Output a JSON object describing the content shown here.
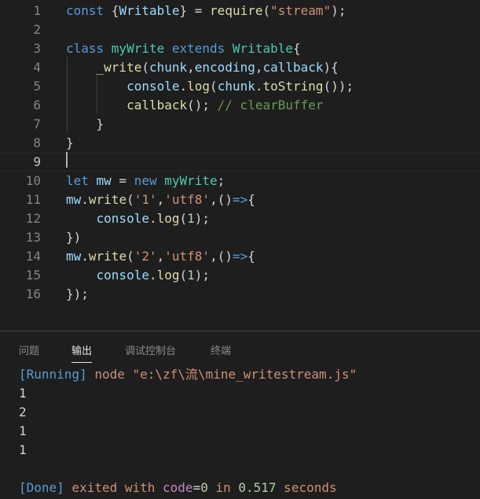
{
  "editor": {
    "line_numbers": [
      "1",
      "2",
      "3",
      "4",
      "5",
      "6",
      "7",
      "8",
      "9",
      "10",
      "11",
      "12",
      "13",
      "14",
      "15",
      "16"
    ],
    "lines": [
      [
        {
          "t": "const ",
          "c": "kw"
        },
        {
          "t": "{",
          "c": "punc"
        },
        {
          "t": "Writable",
          "c": "var"
        },
        {
          "t": "}",
          "c": "punc"
        },
        {
          "t": " = ",
          "c": "punc"
        },
        {
          "t": "require",
          "c": "fn"
        },
        {
          "t": "(",
          "c": "punc"
        },
        {
          "t": "\"stream\"",
          "c": "str"
        },
        {
          "t": ");",
          "c": "punc"
        }
      ],
      [],
      [
        {
          "t": "class ",
          "c": "kw"
        },
        {
          "t": "myWrite ",
          "c": "cls"
        },
        {
          "t": "extends ",
          "c": "kw"
        },
        {
          "t": "Writable",
          "c": "cls"
        },
        {
          "t": "{",
          "c": "punc"
        }
      ],
      [
        {
          "t": "    ",
          "c": "punc"
        },
        {
          "t": "_write",
          "c": "fn"
        },
        {
          "t": "(",
          "c": "punc"
        },
        {
          "t": "chunk",
          "c": "var"
        },
        {
          "t": ",",
          "c": "punc"
        },
        {
          "t": "encoding",
          "c": "var"
        },
        {
          "t": ",",
          "c": "punc"
        },
        {
          "t": "callback",
          "c": "var"
        },
        {
          "t": "){",
          "c": "punc"
        }
      ],
      [
        {
          "t": "        ",
          "c": "punc"
        },
        {
          "t": "console",
          "c": "var"
        },
        {
          "t": ".",
          "c": "punc"
        },
        {
          "t": "log",
          "c": "fn"
        },
        {
          "t": "(",
          "c": "punc"
        },
        {
          "t": "chunk",
          "c": "var"
        },
        {
          "t": ".",
          "c": "punc"
        },
        {
          "t": "toString",
          "c": "fn"
        },
        {
          "t": "());",
          "c": "punc"
        }
      ],
      [
        {
          "t": "        ",
          "c": "punc"
        },
        {
          "t": "callback",
          "c": "fn"
        },
        {
          "t": "(); ",
          "c": "punc"
        },
        {
          "t": "// clearBuffer",
          "c": "cmt"
        }
      ],
      [
        {
          "t": "    }",
          "c": "punc"
        }
      ],
      [
        {
          "t": "}",
          "c": "punc"
        }
      ],
      [],
      [
        {
          "t": "let ",
          "c": "kw"
        },
        {
          "t": "mw",
          "c": "var"
        },
        {
          "t": " = ",
          "c": "punc"
        },
        {
          "t": "new ",
          "c": "kw"
        },
        {
          "t": "myWrite",
          "c": "cls"
        },
        {
          "t": ";",
          "c": "punc"
        }
      ],
      [
        {
          "t": "mw",
          "c": "var"
        },
        {
          "t": ".",
          "c": "punc"
        },
        {
          "t": "write",
          "c": "fn"
        },
        {
          "t": "(",
          "c": "punc"
        },
        {
          "t": "'1'",
          "c": "str"
        },
        {
          "t": ",",
          "c": "punc"
        },
        {
          "t": "'utf8'",
          "c": "str"
        },
        {
          "t": ",()",
          "c": "punc"
        },
        {
          "t": "=>",
          "c": "kw"
        },
        {
          "t": "{",
          "c": "punc"
        }
      ],
      [
        {
          "t": "    ",
          "c": "punc"
        },
        {
          "t": "console",
          "c": "var"
        },
        {
          "t": ".",
          "c": "punc"
        },
        {
          "t": "log",
          "c": "fn"
        },
        {
          "t": "(",
          "c": "punc"
        },
        {
          "t": "1",
          "c": "num"
        },
        {
          "t": ");",
          "c": "punc"
        }
      ],
      [
        {
          "t": "})",
          "c": "punc"
        }
      ],
      [
        {
          "t": "mw",
          "c": "var"
        },
        {
          "t": ".",
          "c": "punc"
        },
        {
          "t": "write",
          "c": "fn"
        },
        {
          "t": "(",
          "c": "punc"
        },
        {
          "t": "'2'",
          "c": "str"
        },
        {
          "t": ",",
          "c": "punc"
        },
        {
          "t": "'utf8'",
          "c": "str"
        },
        {
          "t": ",()",
          "c": "punc"
        },
        {
          "t": "=>",
          "c": "kw"
        },
        {
          "t": "{",
          "c": "punc"
        }
      ],
      [
        {
          "t": "    ",
          "c": "punc"
        },
        {
          "t": "console",
          "c": "var"
        },
        {
          "t": ".",
          "c": "punc"
        },
        {
          "t": "log",
          "c": "fn"
        },
        {
          "t": "(",
          "c": "punc"
        },
        {
          "t": "1",
          "c": "num"
        },
        {
          "t": ");",
          "c": "punc"
        }
      ],
      [
        {
          "t": "});",
          "c": "punc"
        }
      ]
    ]
  },
  "panel": {
    "tabs": [
      {
        "label": "问题"
      },
      {
        "label": "输出"
      },
      {
        "label": "调试控制台"
      },
      {
        "label": "终端"
      }
    ],
    "active_tab": "输出",
    "output": [
      [
        {
          "t": "[Running]",
          "c": "blue"
        },
        {
          "t": " node ",
          "c": "orange"
        },
        {
          "t": "\"e:\\zf\\流\\mine_writestream.js\"",
          "c": "orange"
        }
      ],
      [
        {
          "t": "1",
          "c": "plain"
        }
      ],
      [
        {
          "t": "2",
          "c": "plain"
        }
      ],
      [
        {
          "t": "1",
          "c": "plain"
        }
      ],
      [
        {
          "t": "1",
          "c": "plain"
        }
      ],
      [],
      [
        {
          "t": "[Done]",
          "c": "blue"
        },
        {
          "t": " exited with ",
          "c": "orange"
        },
        {
          "t": "code",
          "c": "pink"
        },
        {
          "t": "=",
          "c": "plain"
        },
        {
          "t": "0",
          "c": "num"
        },
        {
          "t": " in ",
          "c": "orange"
        },
        {
          "t": "0.517",
          "c": "num"
        },
        {
          "t": " seconds",
          "c": "orange"
        }
      ]
    ]
  },
  "colors": {
    "background": "#1e1e1e",
    "keyword": "#569cd6",
    "string": "#ce9178",
    "class": "#4ec9b0",
    "function": "#dcdcaa",
    "variable": "#9cdcfe",
    "comment": "#6a9955"
  }
}
